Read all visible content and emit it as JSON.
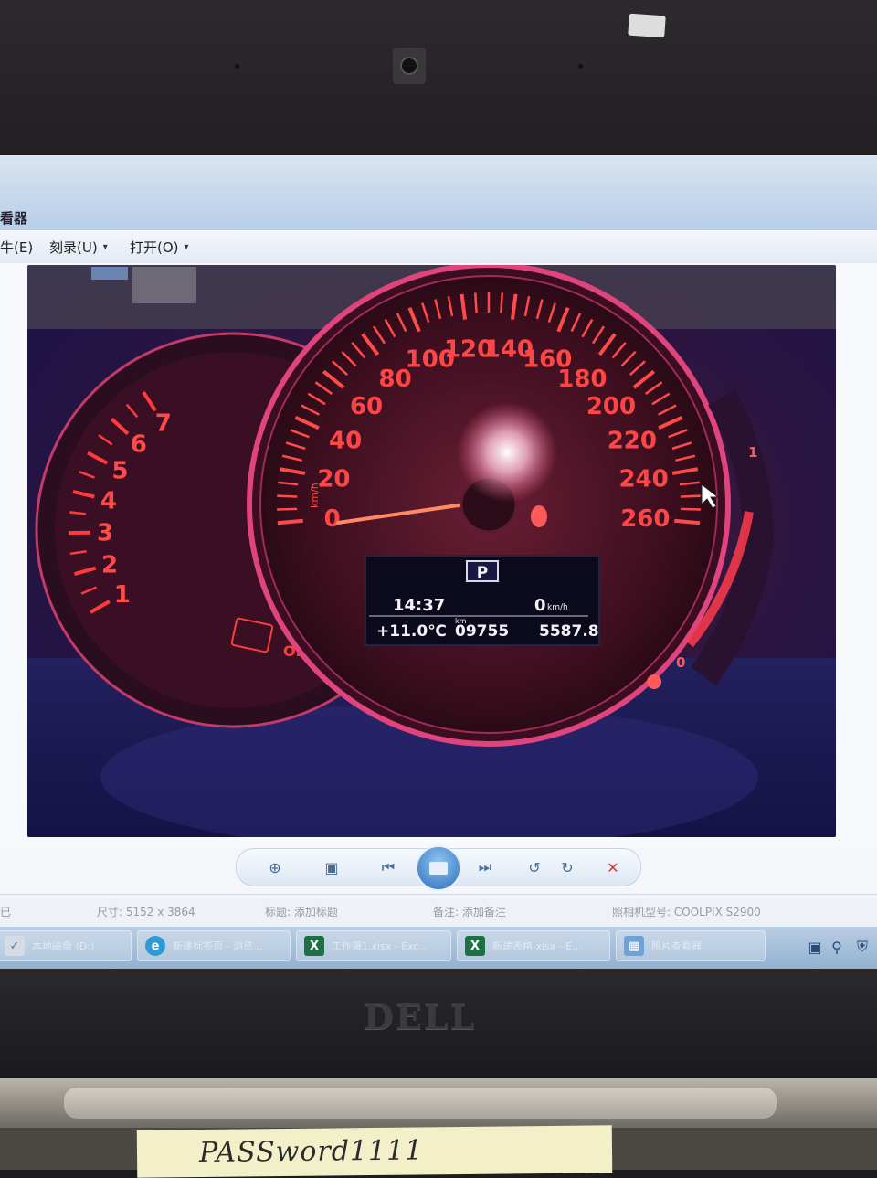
{
  "window": {
    "title": "看器"
  },
  "menu": {
    "items": [
      {
        "label": "牛(E)"
      },
      {
        "label": "刻录(U)",
        "caret": "▾"
      },
      {
        "label": "打开(O)",
        "caret": "▾"
      }
    ]
  },
  "photo": {
    "speedometer": {
      "unit": "km/h",
      "labels": [
        "0",
        "20",
        "40",
        "60",
        "80",
        "100",
        "120",
        "140",
        "160",
        "180",
        "200",
        "220",
        "240",
        "260"
      ]
    },
    "tachometer": {
      "labels": [
        "1",
        "2",
        "3",
        "4",
        "5",
        "6",
        "7"
      ],
      "off_label": "OFF"
    },
    "lcd": {
      "gear": "P",
      "time": "14:37",
      "speed": "0",
      "speed_unit": "km/h",
      "temperature": "+11.0℃",
      "km_label": "km",
      "odometer": "09755",
      "trip": "5587.8"
    },
    "fuel": {
      "full": "1",
      "empty": "0"
    }
  },
  "toolbar": {
    "zoom_icon": "zoom-icon",
    "fit_icon": "fit-icon",
    "prev_icon": "previous-icon",
    "play_icon": "slideshow-icon",
    "next_icon": "next-icon",
    "rotate_ccw_icon": "rotate-ccw-icon",
    "rotate_cw_icon": "rotate-cw-icon",
    "delete_icon": "delete-icon"
  },
  "status": {
    "left": "已",
    "size": "尺寸: 5152 x 3864",
    "title": "标题: 添加标题",
    "note": "备注: 添加备注",
    "camera": "照相机型号: COOLPIX S2900"
  },
  "taskbar": {
    "items": [
      {
        "label": "本地磁盘 (D:)"
      },
      {
        "label": "新建标签页 - 浏览..."
      },
      {
        "label": "工作簿1.xlsx - Exc..."
      },
      {
        "label": "新建表格.xlsx - E..."
      },
      {
        "label": "照片查看器"
      }
    ]
  },
  "laptop": {
    "brand": "DELL"
  },
  "note": {
    "handwriting": "PASSword1111"
  }
}
